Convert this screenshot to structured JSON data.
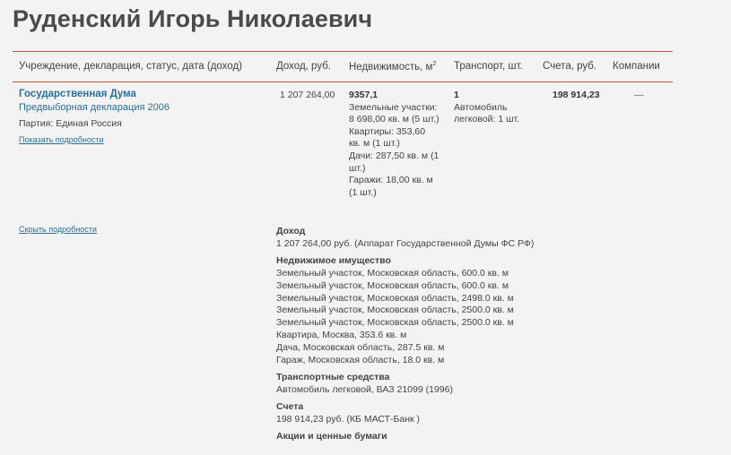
{
  "person": {
    "name": "Руденский Игорь Николаевич"
  },
  "table": {
    "headers": {
      "institution": "Учреждение, декларация, статус, дата (доход)",
      "income": "Доход, руб.",
      "realty": "Недвижимость, м",
      "realty_sup": "2",
      "transport": "Транспорт, шт.",
      "accounts": "Счета, руб.",
      "companies": "Компании"
    },
    "row": {
      "institution": "Государственная Дума",
      "declaration": "Предвыборная декларация 2006",
      "party": "Партия: Единая Россия",
      "show_details": "Показать подробности",
      "income": "1 207 264,00",
      "realty_total": "9357,1",
      "realty_lines": [
        "Земельные участки:",
        "8 698,00 кв. м (5 шт.)",
        "Квартиры: 353,60",
        "кв. м (1 шт.)",
        "Дачи: 287,50 кв. м (1",
        "шт.)",
        "Гаражи: 18,00 кв. м",
        "(1 шт.)"
      ],
      "transport_total": "1",
      "transport_lines": [
        "Автомобиль",
        "легковой: 1 шт."
      ],
      "accounts": "198 914,23",
      "companies": "—"
    }
  },
  "details": {
    "hide_details": "Скрыть подробности",
    "income_title": "Доход",
    "income_value": "1 207 264,00 руб. (Аппарат Государственной Думы ФС РФ)",
    "realty_title": "Недвижимое имущество",
    "realty_items": [
      "Земельный участок, Московская область, 600.0 кв. м",
      "Земельный участок, Московская область, 600.0 кв. м",
      "Земельный участок, Московская область, 2498.0 кв. м",
      "Земельный участок, Московская область, 2500.0 кв. м",
      "Земельный участок, Московская область, 2500.0 кв. м",
      "Квартира, Москва, 353.6 кв. м",
      "Дача, Московская область, 287.5 кв. м",
      "Гараж, Московская область, 18.0 кв. м"
    ],
    "transport_title": "Транспортные средства",
    "transport_value": "Автомобиль легковой, ВАЗ 21099 (1996)",
    "accounts_title": "Счета",
    "accounts_value": "198 914,23 руб. (КБ МАСТ-Банк )",
    "securities_title": "Акции и ценные бумаги"
  },
  "colors": {
    "link": "#2a6f98",
    "rule": "#c8563a",
    "background": "#f3f3f3"
  }
}
